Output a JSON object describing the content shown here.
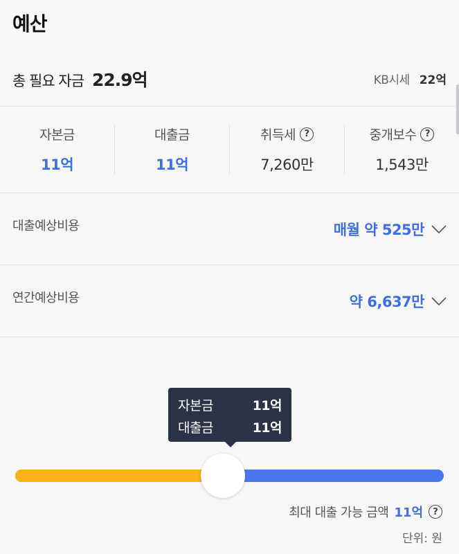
{
  "header": {
    "title": "예산"
  },
  "total": {
    "label": "총 필요 자금",
    "value": "22.9억",
    "kb_label": "KB시세",
    "kb_value": "22억"
  },
  "stats": [
    {
      "label": "자본금",
      "value": "11억",
      "highlight": true
    },
    {
      "label": "대출금",
      "value": "11억",
      "highlight": true
    },
    {
      "label": "취득세",
      "value": "7,260만",
      "help": true
    },
    {
      "label": "중개보수",
      "value": "1,543만",
      "help": true
    }
  ],
  "loan_cost": {
    "label": "대출예상비용",
    "value": "매월 약 525만"
  },
  "annual_cost": {
    "label": "연간예상비용",
    "value": "약 6,637만"
  },
  "slider": {
    "capital_label": "자본금",
    "capital_value": "11억",
    "loan_label": "대출금",
    "loan_value": "11억",
    "position_fraction": 0.5,
    "max_label": "최대 대출 가능 금액",
    "max_value": "11억",
    "unit": "단위: 원",
    "colors": {
      "capital": "#fbb117",
      "loan": "#4a76ec"
    }
  },
  "icons": {
    "help": "?",
    "chevron": "chevron-down-icon"
  }
}
